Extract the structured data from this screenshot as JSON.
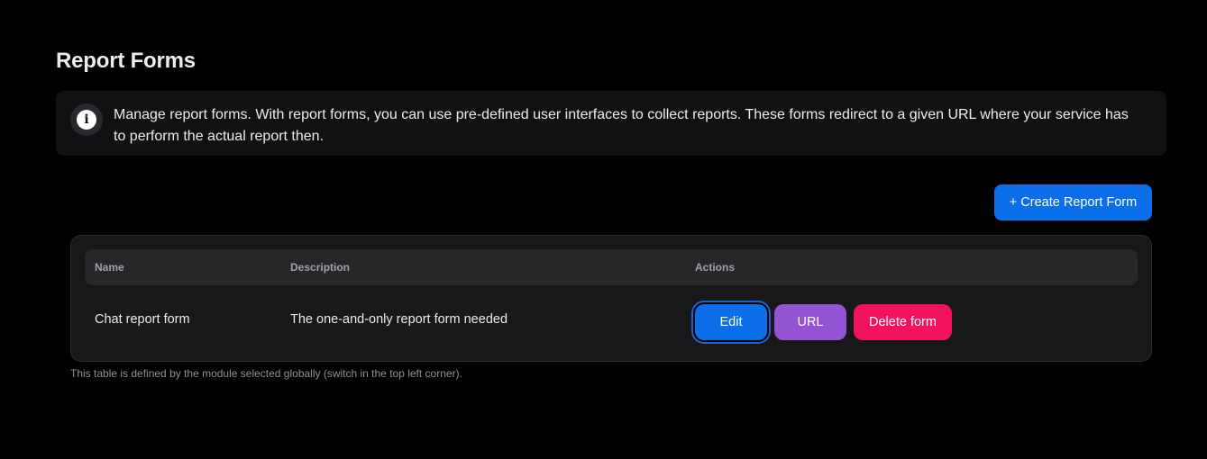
{
  "page": {
    "title": "Report Forms"
  },
  "info": {
    "icon": "info-icon",
    "text": "Manage report forms. With report forms, you can use pre-defined user interfaces to collect reports. These forms redirect to a given URL where your service has to perform the actual report then."
  },
  "toolbar": {
    "create_label": "+ Create Report Form"
  },
  "table": {
    "columns": [
      "Name",
      "Description",
      "Actions"
    ],
    "rows": [
      {
        "name": "Chat report form",
        "description": "The one-and-only report form needed",
        "actions": {
          "edit": "Edit",
          "url": "URL",
          "delete": "Delete form"
        }
      }
    ],
    "footnote": "This table is defined by the module selected globally (switch in the top left corner)."
  },
  "colors": {
    "background": "#000000",
    "primary": "#0a6fe8",
    "secondary": "#9353d3",
    "danger": "#f31260",
    "surface": "#18181b"
  }
}
